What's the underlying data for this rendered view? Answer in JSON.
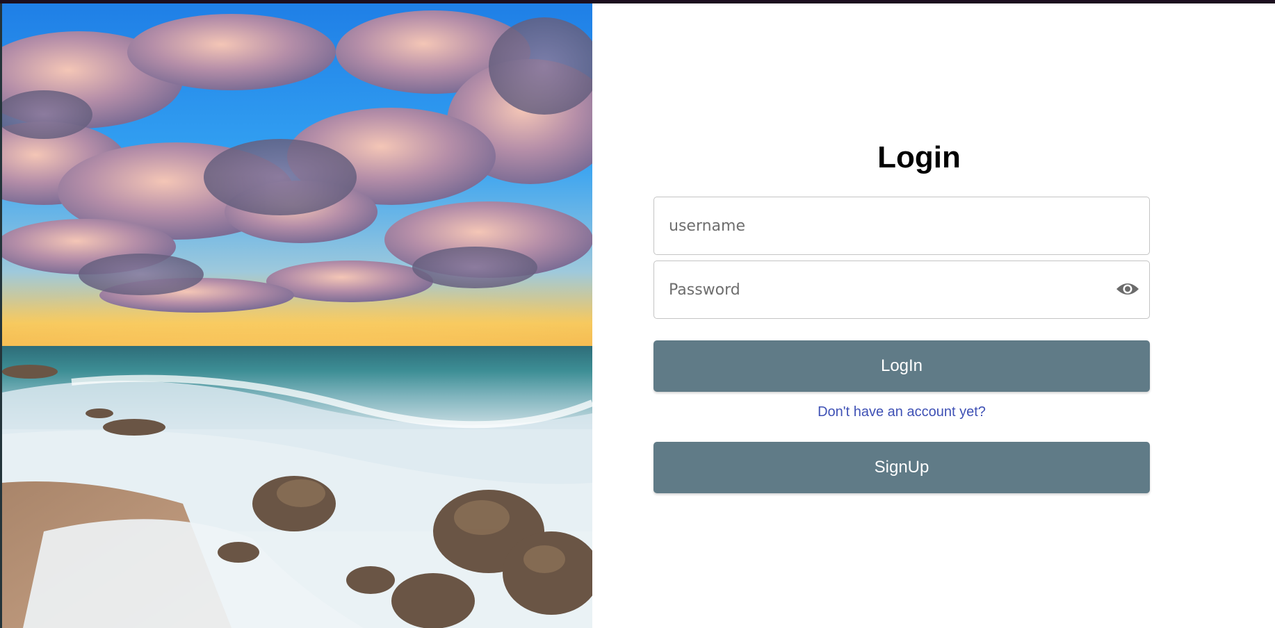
{
  "hero": {
    "image": "beach-sunset-clouds-photo"
  },
  "login": {
    "title": "Login",
    "username": {
      "placeholder": "username",
      "value": ""
    },
    "password": {
      "placeholder": "Password",
      "value": ""
    },
    "toggle_icon": "eye-icon",
    "login_button": "LogIn",
    "signup_prompt": "Don't have an account yet?",
    "signup_button": "SignUp"
  },
  "colors": {
    "button": "#607b87",
    "link": "#3f51b5",
    "topbar": "#1c0f1f"
  }
}
